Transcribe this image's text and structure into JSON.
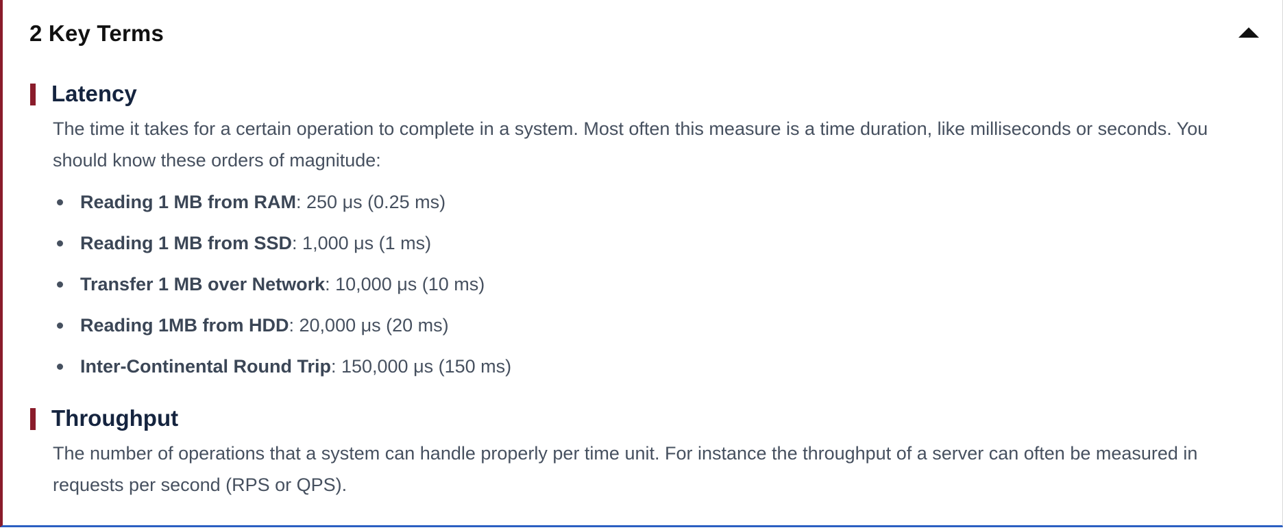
{
  "panel": {
    "title": "2 Key Terms",
    "toggle_icon": "caret-up-icon",
    "accent_color": "#8a1c2b",
    "bottom_border_color": "#2b5fc2"
  },
  "sections": [
    {
      "title": "Latency",
      "description": "The time it takes for a certain operation to complete in a system. Most often this measure is a time duration, like milliseconds or seconds. You should know these orders of magnitude:",
      "bullets": [
        {
          "term": "Reading 1 MB from RAM",
          "value": ": 250 μs (0.25 ms)"
        },
        {
          "term": "Reading 1 MB from SSD",
          "value": ": 1,000 μs (1 ms)"
        },
        {
          "term": "Transfer 1 MB over Network",
          "value": ": 10,000 μs (10 ms)"
        },
        {
          "term": "Reading 1MB from HDD",
          "value": ": 20,000 μs (20 ms)"
        },
        {
          "term": "Inter-Continental Round Trip",
          "value": ": 150,000 μs (150 ms)"
        }
      ]
    },
    {
      "title": "Throughput",
      "description": "The number of operations that a system can handle properly per time unit. For instance the throughput of a server can often be measured in requests per second (RPS or QPS)."
    }
  ]
}
